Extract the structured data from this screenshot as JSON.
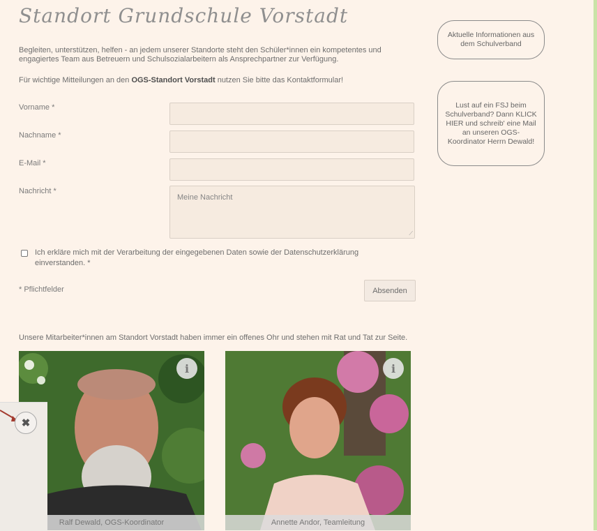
{
  "page": {
    "title": "Standort Grundschule Vorstadt",
    "intro": "Begleiten, unterstützen, helfen - an jedem unserer Standorte steht den Schüler*innen ein kompetentes und engagiertes Team aus Betreuern und Schulsozialarbeitern als Ansprechpartner zur Verfügung.",
    "notice_prefix": "Für wichtige Mitteilungen an den ",
    "notice_bold": "OGS-Standort Vorstadt",
    "notice_suffix": " nutzen Sie bitte das Kontaktformular!"
  },
  "form": {
    "firstname_label": "Vorname *",
    "lastname_label": "Nachname *",
    "email_label": "E-Mail *",
    "message_label": "Nachricht *",
    "message_placeholder": "Meine Nachricht",
    "consent_text": "Ich erkläre mich mit der Verarbeitung der eingegebenen Daten sowie der Datenschutzerklärung einverstanden. *",
    "required_note": "* Pflichtfelder",
    "submit_label": "Absenden"
  },
  "sidebar": {
    "info_link": "Aktuelle Informationen aus dem Schulverband",
    "fsj_link": "Lust auf ein FSJ beim Schulverband? Dann KLICK HIER und schreib' eine Mail an unseren OGS-Koordinator Herrn Dewald!"
  },
  "team": {
    "intro": "Unsere Mitarbeiter*innen am Standort Vorstadt haben immer ein offenes Ohr und stehen mit Rat und Tat zur Seite.",
    "members": [
      {
        "caption": "Ralf Dewald, OGS-Koordinator",
        "info_icon": "info-icon"
      },
      {
        "caption": "Annette Andor, Teamleitung",
        "info_icon": "info-icon"
      }
    ]
  },
  "overlay": {
    "close_icon": "close-icon"
  },
  "colors": {
    "background": "#fdf3ea",
    "field": "#f6ebe0",
    "border": "#d9cfc5",
    "edge": "#c9e3a7"
  }
}
